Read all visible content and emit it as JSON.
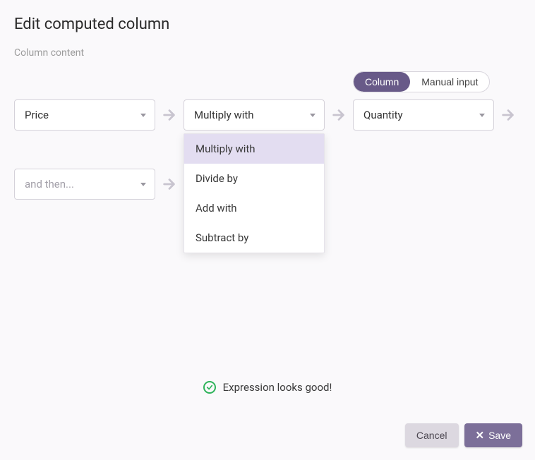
{
  "header": {
    "title": "Edit computed column",
    "subtitle": "Column content"
  },
  "toggle": {
    "column": "Column",
    "manual": "Manual input"
  },
  "row1": {
    "left_select": "Price",
    "op_select": "Multiply with",
    "right_select": "Quantity"
  },
  "row2": {
    "left_placeholder": "and then..."
  },
  "op_dropdown": {
    "items": [
      "Multiply with",
      "Divide by",
      "Add with",
      "Subtract by"
    ]
  },
  "status": {
    "text_prefix": "Expression",
    "text_suffix": " looks good!"
  },
  "footer": {
    "cancel": "Cancel",
    "save": "Save"
  }
}
